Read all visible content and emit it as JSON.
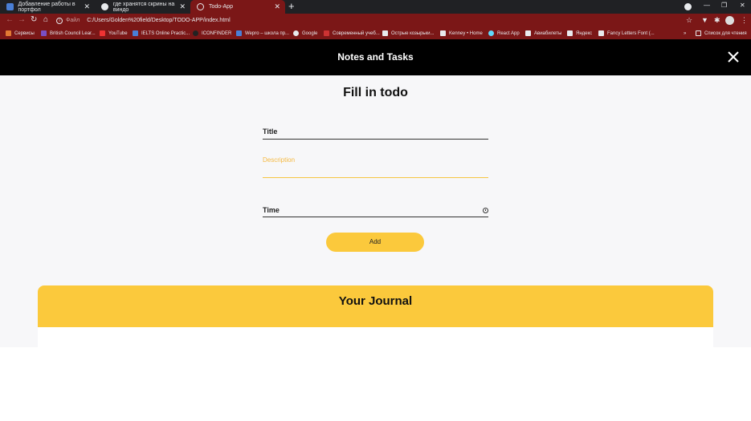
{
  "browser": {
    "tabs": [
      {
        "label": "Добавление работы в портфол",
        "fav_color": "#4a7fd6",
        "fav_letter": "W"
      },
      {
        "label": "где хранятся скрины на виндо",
        "fav_color": "#e8eaed",
        "fav_letter": "G"
      },
      {
        "label": "Todo-App",
        "fav_color": "#c44",
        "fav_letter": ""
      }
    ],
    "new_tab": "+",
    "address": {
      "protocol_label": "Файл",
      "url": "C:/Users/Golden%20field/Desktop/TODO-APP/index.html"
    },
    "bookmarks": [
      {
        "label": "Сервисы",
        "color": "#e27a33"
      },
      {
        "label": "British Council Lear...",
        "color": "#7a4fc4"
      },
      {
        "label": "YouTube",
        "color": "#e33"
      },
      {
        "label": "IELTS Online Practic...",
        "color": "#4a7fd6"
      },
      {
        "label": "ICONFINDER",
        "color": "#222"
      },
      {
        "label": "Wepro – школа пр...",
        "color": "#4a7fd6"
      },
      {
        "label": "Google",
        "color": "#e8eaed"
      },
      {
        "label": "Современный учеб...",
        "color": "#c33"
      },
      {
        "label": "Острые козырьки...",
        "color": "#e8eaed"
      },
      {
        "label": "Kenney • Home",
        "color": "#e8eaed"
      },
      {
        "label": "React App",
        "color": "#61dafb"
      },
      {
        "label": "Авиабилеты",
        "color": "#e8eaed"
      },
      {
        "label": "Яндекс",
        "color": "#e8eaed"
      },
      {
        "label": "Fancy Letters Font (...",
        "color": "#e8eaed"
      }
    ],
    "bookmarks_more": "»",
    "reading_list": "Список для чтения"
  },
  "app": {
    "header_title": "Notes and Tasks",
    "form_heading": "Fill in todo",
    "fields": {
      "title_label": "Title",
      "description_label": "Description",
      "time_label": "Time"
    },
    "add_button": "Add",
    "journal_title": "Your Journal"
  },
  "colors": {
    "header_bg": "#000000",
    "accent": "#fbc93c",
    "browser_chrome": "#7b1717"
  }
}
